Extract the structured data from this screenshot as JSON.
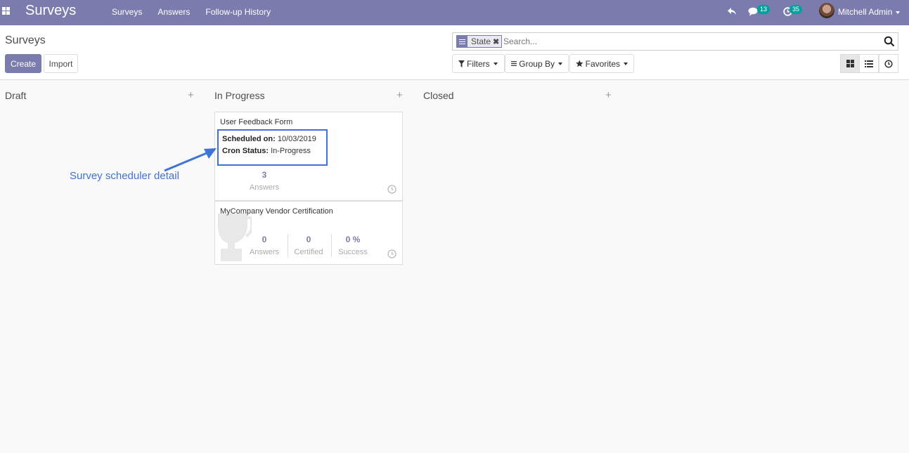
{
  "navbar": {
    "app_title": "Surveys",
    "menu": [
      "Surveys",
      "Answers",
      "Follow-up History"
    ],
    "messages_count": "13",
    "activities_count": "35",
    "user_name": "Mitchell Admin"
  },
  "control_panel": {
    "breadcrumb": "Surveys",
    "create_label": "Create",
    "import_label": "Import",
    "search": {
      "facet_label": "State",
      "placeholder": "Search..."
    },
    "filters_label": "Filters",
    "group_by_label": "Group By",
    "favorites_label": "Favorites"
  },
  "kanban": {
    "columns": [
      {
        "name": "Draft"
      },
      {
        "name": "In Progress"
      },
      {
        "name": "Closed"
      }
    ],
    "cards": [
      {
        "title": "User Feedback Form",
        "scheduled_label": "Scheduled on:",
        "scheduled_value": "10/03/2019",
        "cron_label": "Cron Status:",
        "cron_value": "In-Progress",
        "answers_count": "3",
        "answers_label": "Answers"
      },
      {
        "title": "MyCompany Vendor Certification",
        "answers_count": "0",
        "answers_label": "Answers",
        "certified_count": "0",
        "certified_label": "Certified",
        "success_count": "0 %",
        "success_label": "Success"
      }
    ]
  },
  "annotation": {
    "text": "Survey scheduler detail"
  },
  "colors": {
    "navbar": "#7c7bad",
    "accent": "#7c7bad",
    "badge": "#00a09d",
    "annotation": "#3f73d4"
  }
}
